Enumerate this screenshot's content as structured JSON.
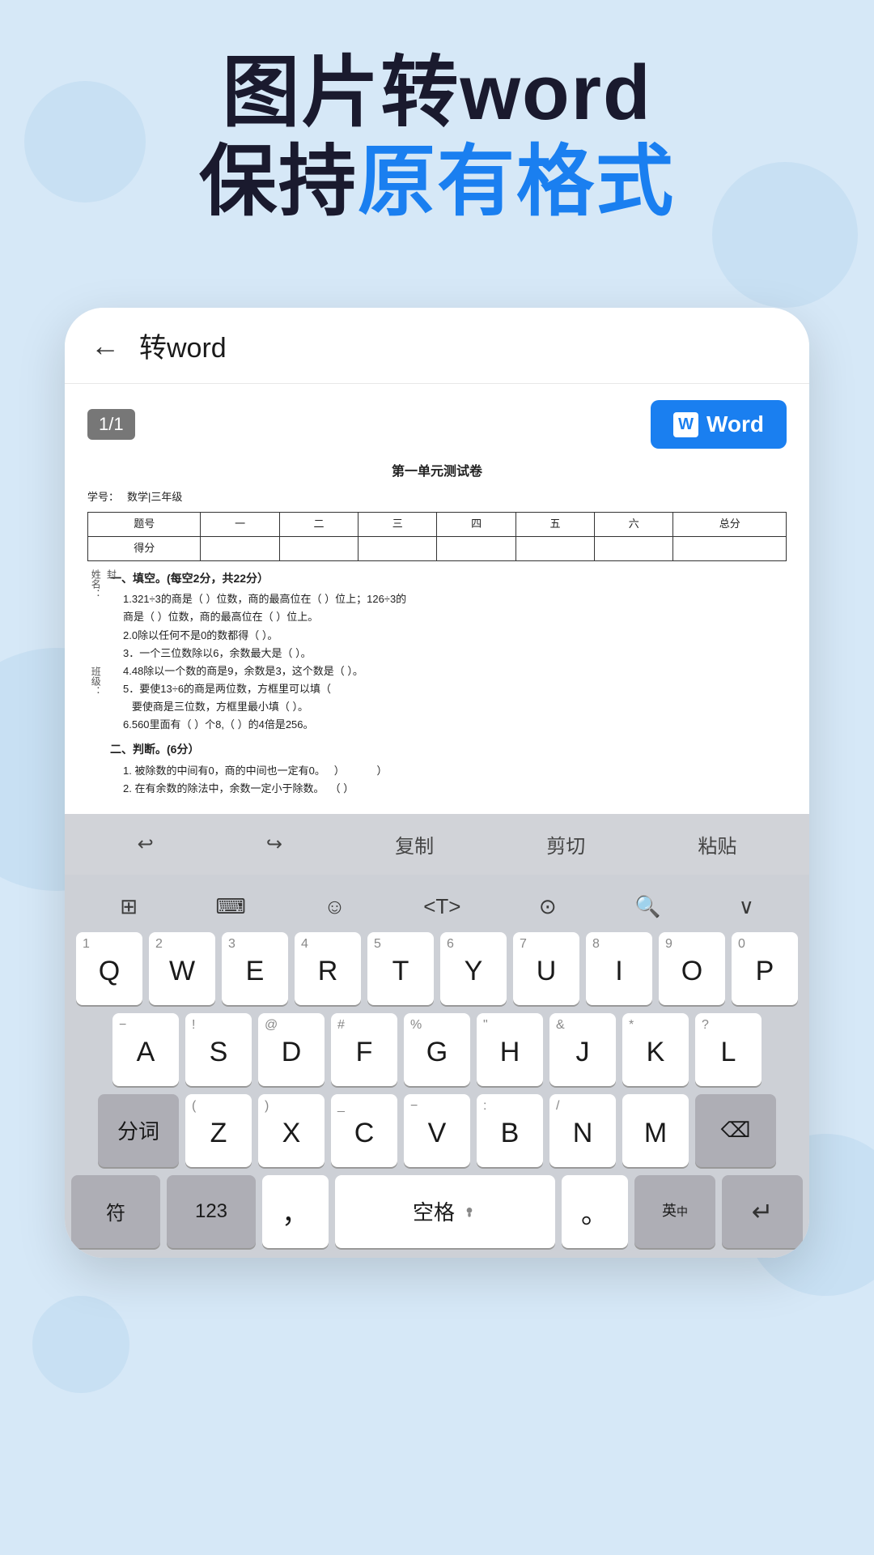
{
  "hero": {
    "line1": "图片转word",
    "line2_start": "保持",
    "line2_accent": "原有格式",
    "accent_color": "#1a7ff0"
  },
  "app": {
    "back_label": "←",
    "title": "转word",
    "page_indicator": "1/1",
    "word_button": "Word"
  },
  "document": {
    "title": "第一单元测试卷",
    "student_id_label": "学号：",
    "student_name": "数学|三年级",
    "name_label": "姓名：",
    "name_value": "封",
    "class_label": "班级：",
    "table_headers": [
      "题号",
      "一",
      "二",
      "三",
      "四",
      "五",
      "六",
      "总分"
    ],
    "table_row2": [
      "得分",
      "",
      "",
      "",
      "",
      "",
      "",
      ""
    ],
    "section1": "一、填空。(每空2分，共22分）",
    "items": [
      "1.321÷3的商是（  ）位数，商的最高位在（  ）位上；126÷3的商是（  ）位数，商的最高位在（  ）位上。",
      "2.0除以任何不是0的数都得（  ）。",
      "3．一个三位数除以6，余数最大是（  ）。",
      "4.48除以一个数的商是9，余数是3，这个数是（  ）。",
      "5．要使13÷6的商是两位数，方框里可以填（    要使商是三位数，方框里最小填（  ）。",
      "6.560里面有（  ）个8,（  ）的4倍是256。"
    ],
    "section2": "二、判断。(6分）",
    "judge_items": [
      "1. 被除数的中间有0，商的中间也一定有0。    ）              ）",
      "2. 在有余数的除法中，余数一定小于除数。   （  ）"
    ]
  },
  "keyboard_toolbar": {
    "undo": "↩",
    "redo": "↪",
    "copy": "复制",
    "cut": "剪切",
    "paste": "粘贴"
  },
  "keyboard": {
    "icon_row": [
      "⊞",
      "⌨",
      "☺",
      "</>",
      "⊙",
      "🔍",
      "∨"
    ],
    "row1": [
      {
        "sub": "1",
        "main": "Q"
      },
      {
        "sub": "2",
        "main": "W"
      },
      {
        "sub": "3",
        "main": "E"
      },
      {
        "sub": "4",
        "main": "R"
      },
      {
        "sub": "5",
        "main": "T"
      },
      {
        "sub": "6",
        "main": "Y"
      },
      {
        "sub": "7",
        "main": "U"
      },
      {
        "sub": "8",
        "main": "I"
      },
      {
        "sub": "9",
        "main": "O"
      },
      {
        "sub": "0",
        "main": "P"
      }
    ],
    "row2": [
      {
        "sub": "−",
        "main": "A"
      },
      {
        "sub": "!",
        "main": "S"
      },
      {
        "sub": "@",
        "main": "D"
      },
      {
        "sub": "#",
        "main": "F"
      },
      {
        "sub": "%",
        "main": "G"
      },
      {
        "sub": "\"",
        "main": "H"
      },
      {
        "sub": "&",
        "main": "J"
      },
      {
        "sub": "*",
        "main": "K"
      },
      {
        "sub": "?",
        "main": "L"
      }
    ],
    "row3": [
      {
        "type": "special",
        "label": "分词"
      },
      {
        "sub": "(",
        "main": "Z"
      },
      {
        "sub": ")",
        "main": "X"
      },
      {
        "sub": "_",
        "main": "C"
      },
      {
        "sub": "−",
        "main": "V"
      },
      {
        "sub": ":",
        "main": "B"
      },
      {
        "sub": "/",
        "main": "N"
      },
      {
        "sub": "",
        "main": "M"
      },
      {
        "type": "special",
        "label": "⌫"
      }
    ],
    "bottom": {
      "func": "符",
      "num": "123",
      "comma": "，",
      "space": "空格",
      "period": "。",
      "lang": "英\n中",
      "enter": "↵"
    }
  }
}
